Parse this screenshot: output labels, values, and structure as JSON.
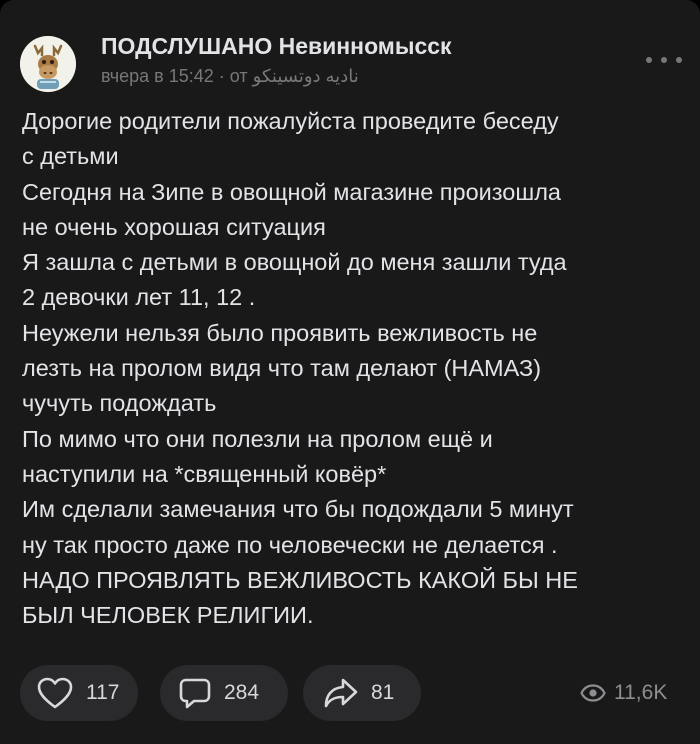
{
  "post": {
    "group_name": "ПОДСЛУШАНО Невинномысск",
    "time": "вчера в 15:42",
    "separator": "·",
    "author_prefix": "от",
    "author": "ناديه دوتسينكو",
    "lines": [
      "Дорогие родители пожалуйста проведите беседу",
      "с детьми",
      "Сегодня на Зипе в овощной магазине произошла",
      "не очень хорошая ситуация",
      "Я зашла с детьми в овощной до меня зашли туда",
      "2 девочки лет 11, 12 .",
      "Неужели нельзя было проявить вежливость не",
      "лезть на пролом видя что там делают (НАМАЗ)",
      "чучуть подождать",
      "По мимо что они полезли на пролом ещё и",
      "наступили на *священный ковёр*",
      "Им сделали замечания что бы подождали 5 минут",
      "ну так просто даже по человечески не делается .",
      "НАДО ПРОЯВЛЯТЬ ВЕЖЛИВОСТЬ КАКОЙ БЫ НЕ",
      "БЫЛ ЧЕЛОВЕК РЕЛИГИИ."
    ]
  },
  "actions": {
    "likes": "117",
    "comments": "284",
    "shares": "81",
    "views": "11,6K"
  },
  "icons": {
    "avatar": "moose-avatar",
    "more": "more-dots-icon",
    "like": "heart-icon",
    "comment": "comment-bubble-icon",
    "share": "share-arrow-icon",
    "views": "eye-icon"
  },
  "colors": {
    "background": "#19191a",
    "text": "#e1e3e6",
    "secondary": "#76787a",
    "button_bg": "#2a2a2c"
  }
}
